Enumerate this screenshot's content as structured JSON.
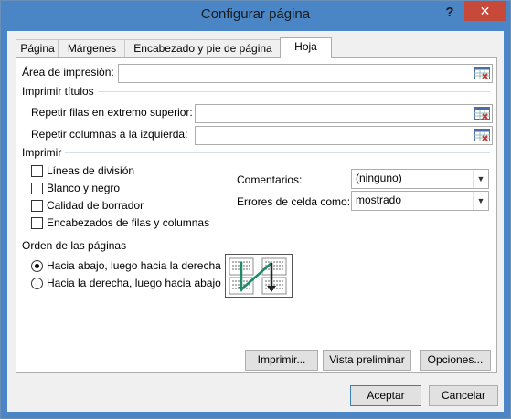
{
  "window": {
    "title": "Configurar página",
    "help": "?",
    "close": "✕"
  },
  "tabs": [
    {
      "label": "Página"
    },
    {
      "label": "Márgenes"
    },
    {
      "label": "Encabezado y pie de página"
    },
    {
      "label": "Hoja"
    }
  ],
  "print_area": {
    "label": "Área de impresión:",
    "value": ""
  },
  "print_titles": {
    "title": "Imprimir títulos",
    "rows_label": "Repetir filas en extremo superior:",
    "rows_value": "",
    "cols_label": "Repetir columnas a la izquierda:",
    "cols_value": ""
  },
  "print": {
    "title": "Imprimir",
    "checks": [
      {
        "label": "Líneas de división",
        "checked": false
      },
      {
        "label": "Blanco y negro",
        "checked": false
      },
      {
        "label": "Calidad de borrador",
        "checked": false
      },
      {
        "label": "Encabezados de filas y columnas",
        "checked": false
      }
    ],
    "comments_label": "Comentarios:",
    "comments_value": "(ninguno)",
    "errors_label": "Errores de celda como:",
    "errors_value": "mostrado"
  },
  "page_order": {
    "title": "Orden de las páginas",
    "options": [
      {
        "label": "Hacia abajo, luego hacia la derecha",
        "selected": true
      },
      {
        "label": "Hacia la derecha, luego hacia abajo",
        "selected": false
      }
    ]
  },
  "buttons": {
    "print": "Imprimir...",
    "preview": "Vista preliminar",
    "options": "Opciones...",
    "accept": "Aceptar",
    "cancel": "Cancelar"
  },
  "colors": {
    "titlebar": "#4a86c5",
    "close": "#c7493a",
    "accent_arrow": "#1f8a6a"
  }
}
